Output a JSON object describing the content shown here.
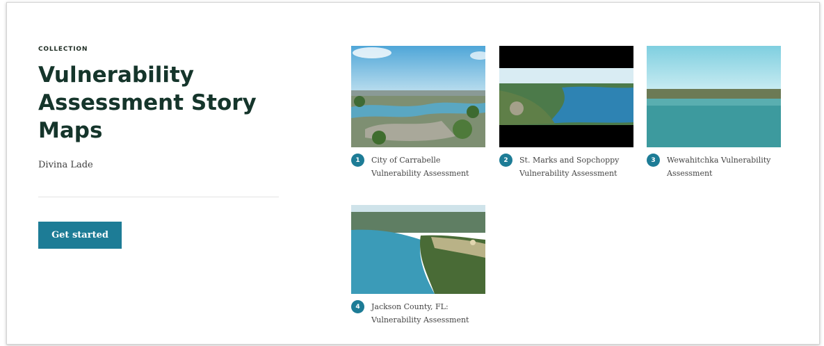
{
  "collection": {
    "eyebrow": "COLLECTION",
    "title": "Vulnerability Assessment Story Maps",
    "author": "Divina Lade",
    "cta_label": "Get started"
  },
  "accent_color": "#1d7c96",
  "items": [
    {
      "number": "1",
      "title": "City of Carrabelle Vulnerability Assessment"
    },
    {
      "number": "2",
      "title": "St. Marks and Sopchoppy Vulnerability Assessment"
    },
    {
      "number": "3",
      "title": "Wewahitchka Vulnerability Assessment"
    },
    {
      "number": "4",
      "title": "Jackson County, FL: Vulnerability Assessment"
    }
  ]
}
